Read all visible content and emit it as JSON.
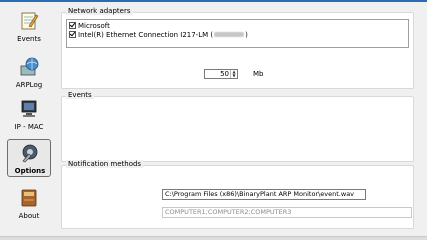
{
  "sidebar": {
    "items": [
      {
        "label": "Events",
        "icon": "events-notepad-icon"
      },
      {
        "label": "ARPLog",
        "icon": "arplog-globe-icon"
      },
      {
        "label": "IP - MAC",
        "icon": "ip-mac-computer-icon"
      },
      {
        "label": "Options",
        "icon": "options-wrench-icon",
        "active": true
      },
      {
        "label": "About",
        "icon": "about-book-icon"
      }
    ]
  },
  "network_adapters": {
    "title": "Network adapters",
    "items": [
      {
        "label": "Microsoft",
        "checked": true
      },
      {
        "label_prefix": "Intel(R) Ethernet Connection I217-LM (",
        "label_suffix": ")",
        "checked": true
      }
    ],
    "size_value": "50",
    "size_unit": "Mb"
  },
  "events": {
    "title": "Events"
  },
  "notification_methods": {
    "title": "Notification methods",
    "sound_file": "C:\\Program Files (x86)\\BinaryPlant ARP Monitor\\event.wav",
    "computers_placeholder": "COMPUTER1;COMPUTER2;COMPUTER3"
  },
  "colors": {
    "accent": "#2b6cb3",
    "panel": "#ffffff",
    "background": "#f0f0f0"
  }
}
